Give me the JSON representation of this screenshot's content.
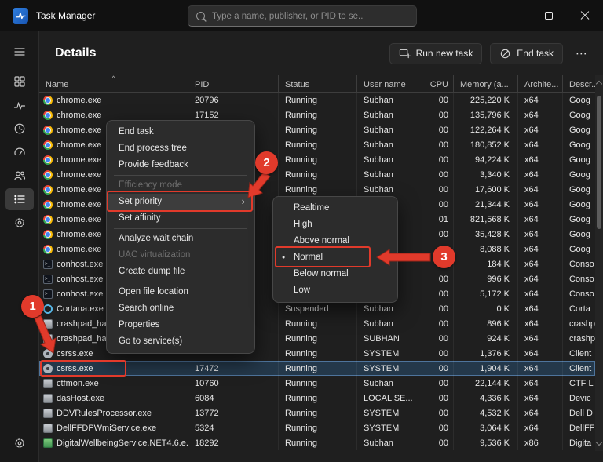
{
  "window": {
    "title": "Task Manager"
  },
  "search": {
    "placeholder": "Type a name, publisher, or PID to se.."
  },
  "sidebar": {
    "items": [
      "menu",
      "processes",
      "performance",
      "app-history",
      "startup-apps",
      "users",
      "details",
      "services"
    ],
    "selected": "details",
    "bottom_item": "settings"
  },
  "header": {
    "title": "Details",
    "run_new_task_label": "Run new task",
    "end_task_label": "End task",
    "more_label": "⋯"
  },
  "table": {
    "sort_indicator": "^",
    "columns": [
      "Name",
      "PID",
      "Status",
      "User name",
      "CPU",
      "Memory (a...",
      "Archite...",
      "Descr..."
    ],
    "rows": [
      {
        "name": "chrome.exe",
        "pid": "20796",
        "status": "Running",
        "user": "Subhan",
        "cpu": "00",
        "memory": "225,220 K",
        "arch": "x64",
        "desc": "Goog",
        "icon": "chrome",
        "state": ""
      },
      {
        "name": "chrome.exe",
        "pid": "17152",
        "status": "Running",
        "user": "Subhan",
        "cpu": "00",
        "memory": "135,796 K",
        "arch": "x64",
        "desc": "Goog",
        "icon": "chrome",
        "state": ""
      },
      {
        "name": "chrome.exe",
        "pid": "",
        "status": "Running",
        "user": "Subhan",
        "cpu": "00",
        "memory": "122,264 K",
        "arch": "x64",
        "desc": "Goog",
        "icon": "chrome",
        "state": ""
      },
      {
        "name": "chrome.exe",
        "pid": "",
        "status": "Running",
        "user": "Subhan",
        "cpu": "00",
        "memory": "180,852 K",
        "arch": "x64",
        "desc": "Goog",
        "icon": "chrome",
        "state": ""
      },
      {
        "name": "chrome.exe",
        "pid": "",
        "status": "Running",
        "user": "Subhan",
        "cpu": "00",
        "memory": "94,224 K",
        "arch": "x64",
        "desc": "Goog",
        "icon": "chrome",
        "state": ""
      },
      {
        "name": "chrome.exe",
        "pid": "",
        "status": "Running",
        "user": "Subhan",
        "cpu": "00",
        "memory": "3,340 K",
        "arch": "x64",
        "desc": "Goog",
        "icon": "chrome",
        "state": ""
      },
      {
        "name": "chrome.exe",
        "pid": "",
        "status": "Running",
        "user": "Subhan",
        "cpu": "00",
        "memory": "17,600 K",
        "arch": "x64",
        "desc": "Goog",
        "icon": "chrome",
        "state": ""
      },
      {
        "name": "chrome.exe",
        "pid": "",
        "status": "",
        "user": "",
        "cpu": "00",
        "memory": "21,344 K",
        "arch": "x64",
        "desc": "Goog",
        "icon": "chrome",
        "state": ""
      },
      {
        "name": "chrome.exe",
        "pid": "",
        "status": "",
        "user": "",
        "cpu": "01",
        "memory": "821,568 K",
        "arch": "x64",
        "desc": "Goog",
        "icon": "chrome",
        "state": ""
      },
      {
        "name": "chrome.exe",
        "pid": "",
        "status": "",
        "user": "",
        "cpu": "00",
        "memory": "35,428 K",
        "arch": "x64",
        "desc": "Goog",
        "icon": "chrome",
        "state": ""
      },
      {
        "name": "chrome.exe",
        "pid": "",
        "status": "",
        "user": "",
        "cpu": "00",
        "memory": "8,088 K",
        "arch": "x64",
        "desc": "Goog",
        "icon": "chrome",
        "state": ""
      },
      {
        "name": "conhost.exe",
        "pid": "",
        "status": "",
        "user": "",
        "cpu": "00",
        "memory": "184 K",
        "arch": "x64",
        "desc": "Conso",
        "icon": "console",
        "state": ""
      },
      {
        "name": "conhost.exe",
        "pid": "",
        "status": "",
        "user": "",
        "cpu": "00",
        "memory": "996 K",
        "arch": "x64",
        "desc": "Conso",
        "icon": "console",
        "state": ""
      },
      {
        "name": "conhost.exe",
        "pid": "",
        "status": "",
        "user": "",
        "cpu": "00",
        "memory": "5,172 K",
        "arch": "x64",
        "desc": "Conso",
        "icon": "console",
        "state": ""
      },
      {
        "name": "Cortana.exe",
        "pid": "",
        "status": "Suspended",
        "user": "Subhan",
        "cpu": "00",
        "memory": "0 K",
        "arch": "x64",
        "desc": "Corta",
        "icon": "cortana",
        "state": ""
      },
      {
        "name": "crashpad_handler.exe",
        "pid": "",
        "status": "Running",
        "user": "Subhan",
        "cpu": "00",
        "memory": "896 K",
        "arch": "x64",
        "desc": "crashp",
        "icon": "generic",
        "state": ""
      },
      {
        "name": "crashpad_handler.exe",
        "pid": "",
        "status": "Running",
        "user": "SUBHAN",
        "cpu": "00",
        "memory": "924 K",
        "arch": "x64",
        "desc": "crashp",
        "icon": "generic",
        "state": ""
      },
      {
        "name": "csrss.exe",
        "pid": "",
        "status": "Running",
        "user": "SYSTEM",
        "cpu": "00",
        "memory": "1,376 K",
        "arch": "x64",
        "desc": "Client",
        "icon": "system",
        "state": ""
      },
      {
        "name": "csrss.exe",
        "pid": "17472",
        "status": "Running",
        "user": "SYSTEM",
        "cpu": "00",
        "memory": "1,904 K",
        "arch": "x64",
        "desc": "Client",
        "icon": "system",
        "state": "selected"
      },
      {
        "name": "ctfmon.exe",
        "pid": "10760",
        "status": "Running",
        "user": "Subhan",
        "cpu": "00",
        "memory": "22,144 K",
        "arch": "x64",
        "desc": "CTF L",
        "icon": "generic",
        "state": ""
      },
      {
        "name": "dasHost.exe",
        "pid": "6084",
        "status": "Running",
        "user": "LOCAL SE...",
        "cpu": "00",
        "memory": "4,336 K",
        "arch": "x64",
        "desc": "Devic",
        "icon": "generic",
        "state": ""
      },
      {
        "name": "DDVRulesProcessor.exe",
        "pid": "13772",
        "status": "Running",
        "user": "SYSTEM",
        "cpu": "00",
        "memory": "4,532 K",
        "arch": "x64",
        "desc": "Dell D",
        "icon": "generic",
        "state": ""
      },
      {
        "name": "DellFFDPWmiService.exe",
        "pid": "5324",
        "status": "Running",
        "user": "SYSTEM",
        "cpu": "00",
        "memory": "3,064 K",
        "arch": "x64",
        "desc": "DellFF",
        "icon": "generic",
        "state": ""
      },
      {
        "name": "DigitalWellbeingService.NET4.6.e...",
        "pid": "18292",
        "status": "Running",
        "user": "Subhan",
        "cpu": "00",
        "memory": "9,536 K",
        "arch": "x86",
        "desc": "Digita",
        "icon": "green",
        "state": ""
      }
    ]
  },
  "context_menu": {
    "items": [
      {
        "label": "End task",
        "state": ""
      },
      {
        "label": "End process tree",
        "state": ""
      },
      {
        "label": "Provide feedback",
        "state": ""
      },
      {
        "label": "",
        "state": "separator"
      },
      {
        "label": "Efficiency mode",
        "state": "disabled"
      },
      {
        "label": "Set priority",
        "state": "highlighted has-arrow"
      },
      {
        "label": "Set affinity",
        "state": ""
      },
      {
        "label": "",
        "state": "separator"
      },
      {
        "label": "Analyze wait chain",
        "state": ""
      },
      {
        "label": "UAC virtualization",
        "state": "disabled"
      },
      {
        "label": "Create dump file",
        "state": ""
      },
      {
        "label": "",
        "state": "separator"
      },
      {
        "label": "Open file location",
        "state": ""
      },
      {
        "label": "Search online",
        "state": ""
      },
      {
        "label": "Properties",
        "state": ""
      },
      {
        "label": "Go to service(s)",
        "state": ""
      }
    ]
  },
  "submenu": {
    "items": [
      {
        "label": "Realtime",
        "state": ""
      },
      {
        "label": "High",
        "state": ""
      },
      {
        "label": "Above normal",
        "state": ""
      },
      {
        "label": "Normal",
        "state": "checked"
      },
      {
        "label": "Below normal",
        "state": ""
      },
      {
        "label": "Low",
        "state": ""
      }
    ]
  },
  "annotations": {
    "color": "#e13a2b",
    "badges": [
      {
        "label": "1"
      },
      {
        "label": "2"
      },
      {
        "label": "3"
      }
    ]
  }
}
